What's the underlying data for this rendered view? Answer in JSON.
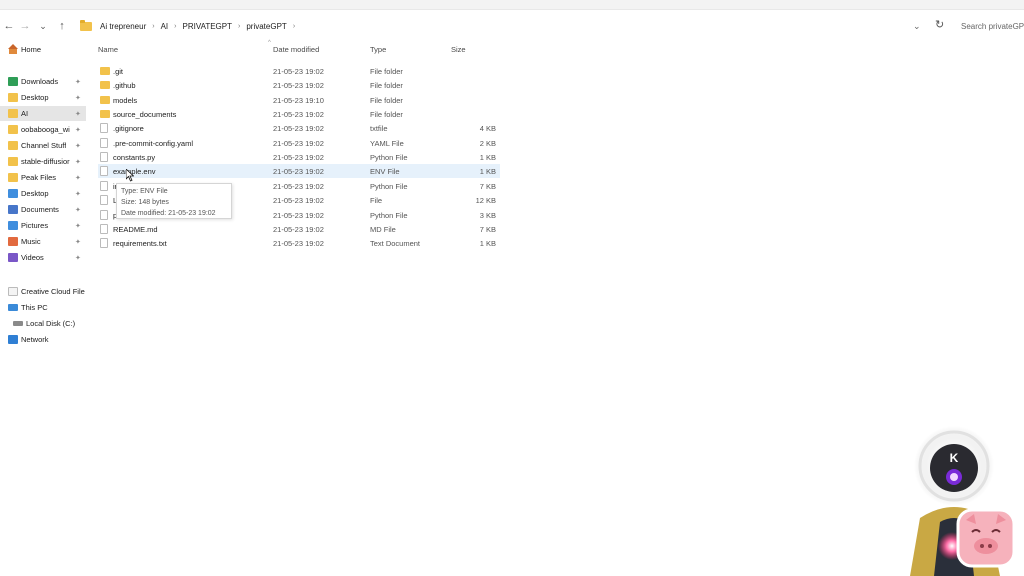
{
  "nav": {
    "back": "←",
    "forward": "→",
    "recent": "⌄",
    "up": "↑",
    "dropdown": "⌄",
    "refresh": "↻"
  },
  "breadcrumb": [
    "Ai trepreneur",
    "AI",
    "PRIVATEGPT",
    "privateGPT"
  ],
  "search": {
    "placeholder": "Search privateGPT"
  },
  "sidebar": {
    "home": "Home",
    "pinned": [
      {
        "label": "Downloads",
        "icon": "download-icon"
      },
      {
        "label": "Desktop",
        "icon": "folder-icon"
      },
      {
        "label": "AI",
        "icon": "folder-icon",
        "selected": true
      },
      {
        "label": "oobabooga_wi",
        "icon": "folder-icon"
      },
      {
        "label": "Channel Stuff",
        "icon": "folder-icon"
      },
      {
        "label": "stable-diffusior",
        "icon": "folder-icon"
      },
      {
        "label": "Peak Files",
        "icon": "folder-icon"
      },
      {
        "label": "Desktop",
        "icon": "desktop-icon"
      },
      {
        "label": "Documents",
        "icon": "documents-icon"
      },
      {
        "label": "Pictures",
        "icon": "pictures-icon"
      },
      {
        "label": "Music",
        "icon": "music-icon"
      },
      {
        "label": "Videos",
        "icon": "videos-icon"
      }
    ],
    "creative_cloud": "Creative Cloud File",
    "this_pc": "This PC",
    "local_disk": "Local Disk (C:)",
    "network": "Network"
  },
  "columns": {
    "name": "Name",
    "date": "Date modified",
    "type": "Type",
    "size": "Size"
  },
  "files": [
    {
      "name": ".git",
      "date": "21-05-23 19:02",
      "type": "File folder",
      "size": "",
      "kind": "folder"
    },
    {
      "name": ".github",
      "date": "21-05-23 19:02",
      "type": "File folder",
      "size": "",
      "kind": "folder"
    },
    {
      "name": "models",
      "date": "21-05-23 19:10",
      "type": "File folder",
      "size": "",
      "kind": "folder"
    },
    {
      "name": "source_documents",
      "date": "21-05-23 19:02",
      "type": "File folder",
      "size": "",
      "kind": "folder"
    },
    {
      "name": ".gitignore",
      "date": "21-05-23 19:02",
      "type": "txtfile",
      "size": "4 KB",
      "kind": "file"
    },
    {
      "name": ".pre-commit-config.yaml",
      "date": "21-05-23 19:02",
      "type": "YAML File",
      "size": "2 KB",
      "kind": "file"
    },
    {
      "name": "constants.py",
      "date": "21-05-23 19:02",
      "type": "Python File",
      "size": "1 KB",
      "kind": "file"
    },
    {
      "name": "example.env",
      "date": "21-05-23 19:02",
      "type": "ENV File",
      "size": "1 KB",
      "kind": "file",
      "hover": true
    },
    {
      "name": "ir",
      "date": "21-05-23 19:02",
      "type": "Python File",
      "size": "7 KB",
      "kind": "file"
    },
    {
      "name": "L",
      "date": "21-05-23 19:02",
      "type": "File",
      "size": "12 KB",
      "kind": "file"
    },
    {
      "name": "p",
      "date": "21-05-23 19:02",
      "type": "Python File",
      "size": "3 KB",
      "kind": "file"
    },
    {
      "name": "README.md",
      "date": "21-05-23 19:02",
      "type": "MD File",
      "size": "7 KB",
      "kind": "file"
    },
    {
      "name": "requirements.txt",
      "date": "21-05-23 19:02",
      "type": "Text Document",
      "size": "1 KB",
      "kind": "file"
    }
  ],
  "tooltip": {
    "type": "Type: ENV File",
    "size": "Size: 148 bytes",
    "date": "Date modified: 21-05-23 19:02"
  },
  "overlay": {
    "mascot_letter": "K"
  }
}
